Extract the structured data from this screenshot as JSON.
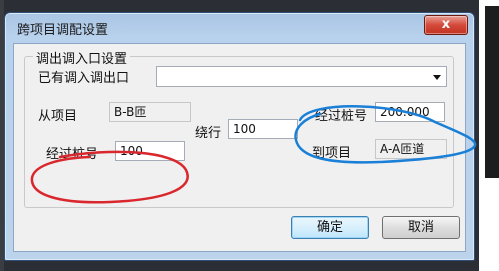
{
  "window": {
    "title": "跨项目调配设置",
    "close_glyph": "x"
  },
  "group": {
    "title": "调出调入口设置"
  },
  "existing_port": {
    "label": "已有调入调出口",
    "value": ""
  },
  "from_project": {
    "label": "从项目",
    "value": "B-B匝"
  },
  "bypass": {
    "label": "绕行",
    "value": "100"
  },
  "from_station": {
    "label": "经过桩号",
    "value": "100"
  },
  "to_station": {
    "label": "经过桩号",
    "value": "200.000"
  },
  "to_project": {
    "label": "到项目",
    "value": "A-A匝道"
  },
  "buttons": {
    "ok": "确定",
    "cancel": "取消"
  },
  "annotation_colors": {
    "red": "#d9272e",
    "blue": "#1a7fd6"
  }
}
